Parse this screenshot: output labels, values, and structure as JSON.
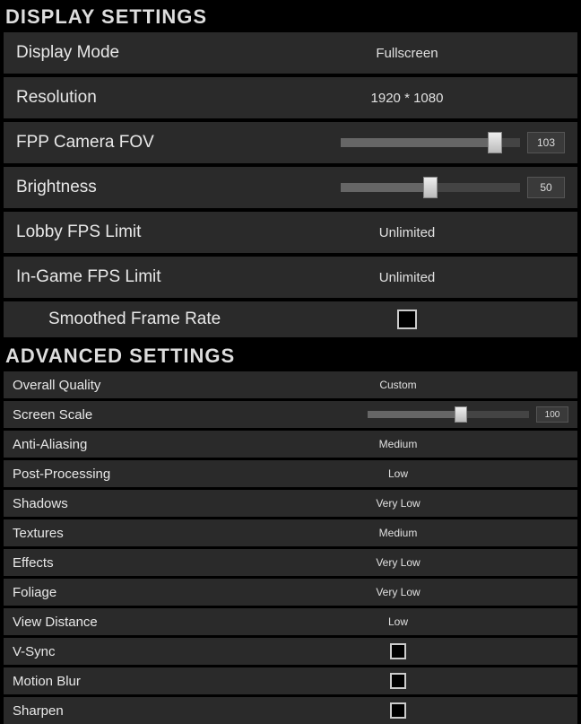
{
  "display": {
    "header": "DISPLAY SETTINGS",
    "mode": {
      "label": "Display Mode",
      "value": "Fullscreen"
    },
    "resolution": {
      "label": "Resolution",
      "value": "1920 * 1080"
    },
    "fov": {
      "label": "FPP Camera FOV",
      "value": "103",
      "pct": 86
    },
    "brightness": {
      "label": "Brightness",
      "value": "50",
      "pct": 50
    },
    "lobby_fps": {
      "label": "Lobby FPS Limit",
      "value": "Unlimited"
    },
    "ingame_fps": {
      "label": "In-Game FPS Limit",
      "value": "Unlimited"
    },
    "smoothed": {
      "label": "Smoothed Frame Rate",
      "checked": false
    }
  },
  "advanced": {
    "header": "ADVANCED SETTINGS",
    "overall": {
      "label": "Overall Quality",
      "value": "Custom"
    },
    "scale": {
      "label": "Screen Scale",
      "value": "100",
      "pct": 58
    },
    "aa": {
      "label": "Anti-Aliasing",
      "value": "Medium"
    },
    "post": {
      "label": "Post-Processing",
      "value": "Low"
    },
    "shadows": {
      "label": "Shadows",
      "value": "Very Low"
    },
    "textures": {
      "label": "Textures",
      "value": "Medium"
    },
    "effects": {
      "label": "Effects",
      "value": "Very Low"
    },
    "foliage": {
      "label": "Foliage",
      "value": "Very Low"
    },
    "view": {
      "label": "View Distance",
      "value": "Low"
    },
    "vsync": {
      "label": "V-Sync",
      "checked": false
    },
    "blur": {
      "label": "Motion Blur",
      "checked": false
    },
    "sharpen": {
      "label": "Sharpen",
      "checked": false
    }
  }
}
